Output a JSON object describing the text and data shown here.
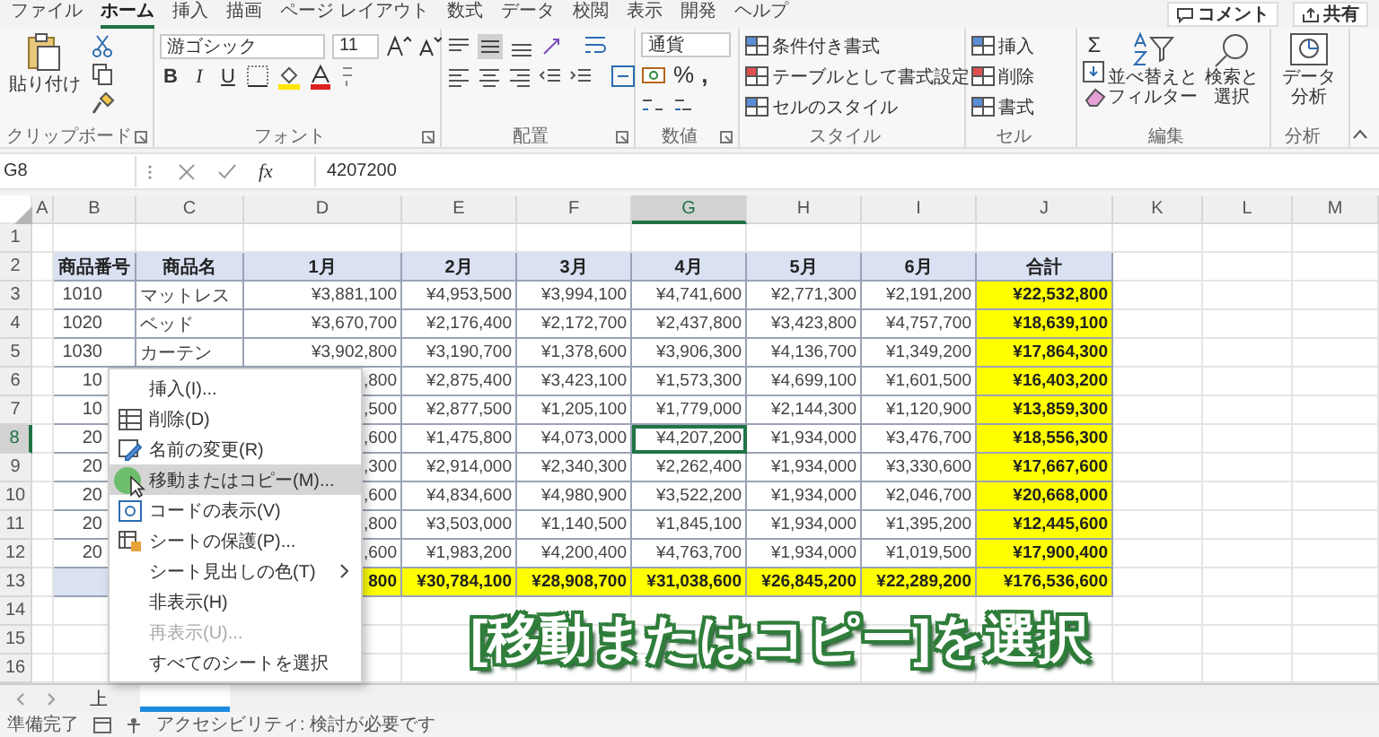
{
  "ribbon_tabs": [
    {
      "label": "ファイル",
      "selected": false
    },
    {
      "label": "ホーム",
      "selected": true
    },
    {
      "label": "挿入",
      "selected": false
    },
    {
      "label": "描画",
      "selected": false
    },
    {
      "label": "ページ レイアウト",
      "selected": false
    },
    {
      "label": "数式",
      "selected": false
    },
    {
      "label": "データ",
      "selected": false
    },
    {
      "label": "校閲",
      "selected": false
    },
    {
      "label": "表示",
      "selected": false
    },
    {
      "label": "開発",
      "selected": false
    },
    {
      "label": "ヘルプ",
      "selected": false
    }
  ],
  "top_actions": [
    {
      "label": "コメント"
    },
    {
      "label": "共有"
    }
  ],
  "ribbon_groups": [
    {
      "kind": "clipboard",
      "label": "クリップボード",
      "paste_label": "貼り付け"
    },
    {
      "kind": "font",
      "label": "フォント",
      "font_name": "游ゴシック",
      "font_size": "11",
      "bold": "B",
      "italic": "I",
      "underline": "U"
    },
    {
      "kind": "alignment",
      "label": "配置"
    },
    {
      "kind": "number",
      "label": "数値",
      "format": "通貨",
      "percent": "%",
      "comma": ","
    },
    {
      "kind": "styles",
      "label": "スタイル",
      "items": [
        "条件付き書式",
        "テーブルとして書式設定",
        "セルのスタイル"
      ]
    },
    {
      "kind": "cells",
      "label": "セル",
      "items": [
        "挿入",
        "削除",
        "書式"
      ]
    },
    {
      "kind": "editing",
      "label": "編集",
      "sum": "Σ",
      "sort": [
        "並べ替えと",
        "フィルター"
      ],
      "find": [
        "検索と",
        "選択"
      ]
    },
    {
      "kind": "analysis",
      "label": "分析",
      "button": [
        "データ",
        "分析"
      ]
    }
  ],
  "formula_bar": {
    "name_box": "G8",
    "function_label": "fx",
    "value": "4207200"
  },
  "columns": [
    {
      "label": "A",
      "selected": false
    },
    {
      "label": "B",
      "selected": false
    },
    {
      "label": "C",
      "selected": false
    },
    {
      "label": "D",
      "selected": false
    },
    {
      "label": "E",
      "selected": false
    },
    {
      "label": "F",
      "selected": false
    },
    {
      "label": "G",
      "selected": true
    },
    {
      "label": "H",
      "selected": false
    },
    {
      "label": "I",
      "selected": false
    },
    {
      "label": "J",
      "selected": false
    },
    {
      "label": "K",
      "selected": false
    },
    {
      "label": "L",
      "selected": false
    },
    {
      "label": "M",
      "selected": false
    }
  ],
  "rows": [
    {
      "number": "1",
      "selected": false,
      "kind": "blank"
    },
    {
      "number": "2",
      "selected": false,
      "kind": "header",
      "cells": [
        "商品番号",
        "商品名",
        "1月",
        "2月",
        "3月",
        "4月",
        "5月",
        "6月",
        "合計"
      ]
    },
    {
      "number": "3",
      "selected": false,
      "kind": "data",
      "cells": [
        "1010",
        "マットレス",
        "¥3,881,100",
        "¥4,953,500",
        "¥3,994,100",
        "¥4,741,600",
        "¥2,771,300",
        "¥2,191,200",
        "¥22,532,800"
      ]
    },
    {
      "number": "4",
      "selected": false,
      "kind": "data",
      "cells": [
        "1020",
        "ベッド",
        "¥3,670,700",
        "¥2,176,400",
        "¥2,172,700",
        "¥2,437,800",
        "¥3,423,800",
        "¥4,757,700",
        "¥18,639,100"
      ]
    },
    {
      "number": "5",
      "selected": false,
      "kind": "data",
      "cells": [
        "1030",
        "カーテン",
        "¥3,902,800",
        "¥3,190,700",
        "¥1,378,600",
        "¥3,906,300",
        "¥4,136,700",
        "¥1,349,200",
        "¥17,864,300"
      ]
    },
    {
      "number": "6",
      "selected": false,
      "kind": "data",
      "cells": [
        "10",
        null,
        ",800",
        "¥2,875,400",
        "¥3,423,100",
        "¥1,573,300",
        "¥4,699,100",
        "¥1,601,500",
        "¥16,403,200"
      ]
    },
    {
      "number": "7",
      "selected": false,
      "kind": "data",
      "cells": [
        "10",
        null,
        ",500",
        "¥2,877,500",
        "¥1,205,100",
        "¥1,779,000",
        "¥2,144,300",
        "¥1,120,900",
        "¥13,859,300"
      ]
    },
    {
      "number": "8",
      "selected": true,
      "kind": "data",
      "cells": [
        "20",
        null,
        ",600",
        "¥1,475,800",
        "¥4,073,000",
        "¥4,207,200",
        "¥1,934,000",
        "¥3,476,700",
        "¥18,556,300"
      ]
    },
    {
      "number": "9",
      "selected": false,
      "kind": "data",
      "cells": [
        "20",
        null,
        ",300",
        "¥2,914,000",
        "¥2,340,300",
        "¥2,262,400",
        "¥1,934,000",
        "¥3,330,600",
        "¥17,667,600"
      ]
    },
    {
      "number": "10",
      "selected": false,
      "kind": "data",
      "cells": [
        "20",
        null,
        ",600",
        "¥4,834,600",
        "¥4,980,900",
        "¥3,522,200",
        "¥1,934,000",
        "¥2,046,700",
        "¥20,668,000"
      ]
    },
    {
      "number": "11",
      "selected": false,
      "kind": "data",
      "cells": [
        "20",
        null,
        ",800",
        "¥3,503,000",
        "¥1,140,500",
        "¥1,845,100",
        "¥1,934,000",
        "¥1,395,200",
        "¥12,445,600"
      ]
    },
    {
      "number": "12",
      "selected": false,
      "kind": "data",
      "cells": [
        "20",
        null,
        ",600",
        "¥1,983,200",
        "¥4,200,400",
        "¥4,763,700",
        "¥1,934,000",
        "¥1,019,500",
        "¥17,900,400"
      ]
    },
    {
      "number": "13",
      "selected": false,
      "kind": "total",
      "cells": [
        null,
        null,
        "800",
        "¥30,784,100",
        "¥28,908,700",
        "¥31,038,600",
        "¥26,845,200",
        "¥22,289,200",
        "¥176,536,600"
      ]
    },
    {
      "number": "14",
      "selected": false,
      "kind": "blank"
    },
    {
      "number": "15",
      "selected": false,
      "kind": "blank"
    },
    {
      "number": "16",
      "selected": false,
      "kind": "blank"
    }
  ],
  "context_menu": [
    {
      "label": "挿入(I)...",
      "selected": false,
      "disabled": false,
      "has_submenu": false
    },
    {
      "label": "削除(D)",
      "selected": false,
      "disabled": false,
      "has_submenu": false
    },
    {
      "label": "名前の変更(R)",
      "selected": false,
      "disabled": false,
      "has_submenu": false
    },
    {
      "label": "移動またはコピー(M)...",
      "selected": true,
      "disabled": false,
      "has_submenu": false
    },
    {
      "label": "コードの表示(V)",
      "selected": false,
      "disabled": false,
      "has_submenu": false
    },
    {
      "label": "シートの保護(P)...",
      "selected": false,
      "disabled": false,
      "has_submenu": false
    },
    {
      "label": "シート見出しの色(T)",
      "selected": false,
      "disabled": false,
      "has_submenu": true
    },
    {
      "label": "非表示(H)",
      "selected": false,
      "disabled": false,
      "has_submenu": false
    },
    {
      "label": "再表示(U)...",
      "selected": false,
      "disabled": true,
      "has_submenu": false
    },
    {
      "label": "すべてのシートを選択",
      "selected": false,
      "disabled": false,
      "has_submenu": false
    }
  ],
  "caption": "[移動またはコピー]を選択",
  "sheet_tabs": [
    {
      "label": "上",
      "selected": false
    },
    {
      "selected": true
    }
  ],
  "status_bar": {
    "ready": "準備完了",
    "accessibility": "アクセシビリティ: 検討が必要です"
  }
}
